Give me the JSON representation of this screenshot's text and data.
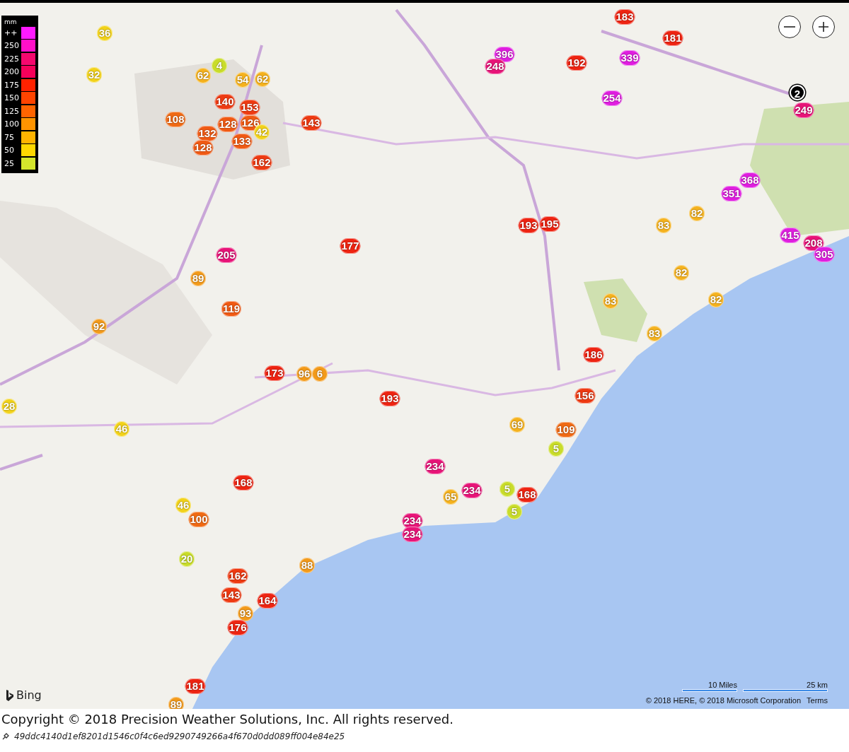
{
  "map": {
    "legend": {
      "unit": "mm",
      "items": [
        {
          "label": "++",
          "color": "#ff1aff"
        },
        {
          "label": "250",
          "color": "#ff10c8"
        },
        {
          "label": "225",
          "color": "#f5086e"
        },
        {
          "label": "200",
          "color": "#f5005a"
        },
        {
          "label": "175",
          "color": "#ff2200"
        },
        {
          "label": "150",
          "color": "#ff4400"
        },
        {
          "label": "125",
          "color": "#ff6400"
        },
        {
          "label": "100",
          "color": "#ff9400"
        },
        {
          "label": "75",
          "color": "#ffb400"
        },
        {
          "label": "50",
          "color": "#ffd800"
        },
        {
          "label": "25",
          "color": "#d4e62c"
        }
      ]
    },
    "markers": [
      {
        "kind": "reading",
        "value": "36",
        "color": "#f2d21a"
      },
      {
        "kind": "reading",
        "value": "32",
        "color": "#f2d21a"
      },
      {
        "kind": "reading",
        "value": "4",
        "color": "#c9dc2a"
      },
      {
        "kind": "reading",
        "value": "62",
        "color": "#f5b21e"
      },
      {
        "kind": "reading",
        "value": "54",
        "color": "#f5b21e"
      },
      {
        "kind": "reading",
        "value": "62",
        "color": "#f5b21e"
      },
      {
        "kind": "reading",
        "value": "140",
        "color": "#ee3a12"
      },
      {
        "kind": "reading",
        "value": "153",
        "color": "#ee3a12"
      },
      {
        "kind": "reading",
        "value": "128",
        "color": "#f05a14"
      },
      {
        "kind": "reading",
        "value": "126",
        "color": "#f05a14"
      },
      {
        "kind": "reading",
        "value": "108",
        "color": "#f06a14"
      },
      {
        "kind": "reading",
        "value": "132",
        "color": "#f05a14"
      },
      {
        "kind": "reading",
        "value": "42",
        "color": "#f2d21a"
      },
      {
        "kind": "reading",
        "value": "133",
        "color": "#f05a14"
      },
      {
        "kind": "reading",
        "value": "128",
        "color": "#f05a14"
      },
      {
        "kind": "reading",
        "value": "162",
        "color": "#ee3a12"
      },
      {
        "kind": "reading",
        "value": "143",
        "color": "#ee3a12"
      },
      {
        "kind": "reading",
        "value": "205",
        "color": "#e81478"
      },
      {
        "kind": "reading",
        "value": "89",
        "color": "#f39a1a"
      },
      {
        "kind": "reading",
        "value": "119",
        "color": "#f05a14"
      },
      {
        "kind": "reading",
        "value": "92",
        "color": "#f39a1a"
      },
      {
        "kind": "reading",
        "value": "177",
        "color": "#ee2412"
      },
      {
        "kind": "reading",
        "value": "396",
        "color": "#e01ee0"
      },
      {
        "kind": "reading",
        "value": "248",
        "color": "#e81478"
      },
      {
        "kind": "reading",
        "value": "192",
        "color": "#ee2412"
      },
      {
        "kind": "reading",
        "value": "183",
        "color": "#ee2412"
      },
      {
        "kind": "reading",
        "value": "181",
        "color": "#ee2412"
      },
      {
        "kind": "reading",
        "value": "339",
        "color": "#e01ee0"
      },
      {
        "kind": "reading",
        "value": "254",
        "color": "#e01ee0"
      },
      {
        "kind": "cluster",
        "value": "2",
        "color": "#000000"
      },
      {
        "kind": "reading",
        "value": "249",
        "color": "#e81478"
      },
      {
        "kind": "reading",
        "value": "368",
        "color": "#e01ee0"
      },
      {
        "kind": "reading",
        "value": "351",
        "color": "#e01ee0"
      },
      {
        "kind": "reading",
        "value": "82",
        "color": "#f5b21e"
      },
      {
        "kind": "reading",
        "value": "83",
        "color": "#f5b21e"
      },
      {
        "kind": "reading",
        "value": "415",
        "color": "#e01ee0"
      },
      {
        "kind": "reading",
        "value": "208",
        "color": "#e81478"
      },
      {
        "kind": "reading",
        "value": "305",
        "color": "#e01ee0"
      },
      {
        "kind": "reading",
        "value": "193",
        "color": "#ee2412"
      },
      {
        "kind": "reading",
        "value": "195",
        "color": "#ee2412"
      },
      {
        "kind": "reading",
        "value": "82",
        "color": "#f5b21e"
      },
      {
        "kind": "reading",
        "value": "83",
        "color": "#f5b21e"
      },
      {
        "kind": "reading",
        "value": "82",
        "color": "#f5b21e"
      },
      {
        "kind": "reading",
        "value": "83",
        "color": "#f5b21e"
      },
      {
        "kind": "reading",
        "value": "186",
        "color": "#ee2412"
      },
      {
        "kind": "reading",
        "value": "156",
        "color": "#ee3a12"
      },
      {
        "kind": "reading",
        "value": "173",
        "color": "#ee2412"
      },
      {
        "kind": "reading",
        "value": "96",
        "color": "#f39a1a"
      },
      {
        "kind": "reading",
        "value": "6",
        "color": "#f39a1a"
      },
      {
        "kind": "reading",
        "value": "193",
        "color": "#ee2412"
      },
      {
        "kind": "reading",
        "value": "28",
        "color": "#f2d21a"
      },
      {
        "kind": "reading",
        "value": "46",
        "color": "#f2d21a"
      },
      {
        "kind": "reading",
        "value": "69",
        "color": "#f5b21e"
      },
      {
        "kind": "reading",
        "value": "109",
        "color": "#f06a14"
      },
      {
        "kind": "reading",
        "value": "5",
        "color": "#c9dc2a"
      },
      {
        "kind": "reading",
        "value": "234",
        "color": "#e81478"
      },
      {
        "kind": "reading",
        "value": "234",
        "color": "#e81478"
      },
      {
        "kind": "reading",
        "value": "65",
        "color": "#f5b21e"
      },
      {
        "kind": "reading",
        "value": "5",
        "color": "#c9dc2a"
      },
      {
        "kind": "reading",
        "value": "168",
        "color": "#ee2412"
      },
      {
        "kind": "reading",
        "value": "5",
        "color": "#c9dc2a"
      },
      {
        "kind": "reading",
        "value": "234",
        "color": "#e81478"
      },
      {
        "kind": "reading",
        "value": "234",
        "color": "#e81478"
      },
      {
        "kind": "reading",
        "value": "168",
        "color": "#ee2412"
      },
      {
        "kind": "reading",
        "value": "46",
        "color": "#f2d21a"
      },
      {
        "kind": "reading",
        "value": "100",
        "color": "#f06a14"
      },
      {
        "kind": "reading",
        "value": "20",
        "color": "#c9dc2a"
      },
      {
        "kind": "reading",
        "value": "88",
        "color": "#f39a1a"
      },
      {
        "kind": "reading",
        "value": "162",
        "color": "#ee3a12"
      },
      {
        "kind": "reading",
        "value": "143",
        "color": "#ee3a12"
      },
      {
        "kind": "reading",
        "value": "164",
        "color": "#ee2412"
      },
      {
        "kind": "reading",
        "value": "93",
        "color": "#f39a1a"
      },
      {
        "kind": "reading",
        "value": "176",
        "color": "#ee2412"
      },
      {
        "kind": "reading",
        "value": "181",
        "color": "#ee2412"
      },
      {
        "kind": "reading",
        "value": "89",
        "color": "#f39a1a"
      }
    ],
    "provider_logo": "Bing",
    "scale": [
      "10 Miles",
      "25 km"
    ],
    "attribution": "© 2018 HERE, © 2018 Microsoft Corporation",
    "terms_link": "Terms"
  },
  "footer": {
    "copyright": "Copyright © 2018 Precision Weather Solutions, Inc. All rights reserved.",
    "hash": "49ddc4140d1ef8201d1546c0f4c6ed9290749266a4f670d0dd089ff004e84e25"
  }
}
